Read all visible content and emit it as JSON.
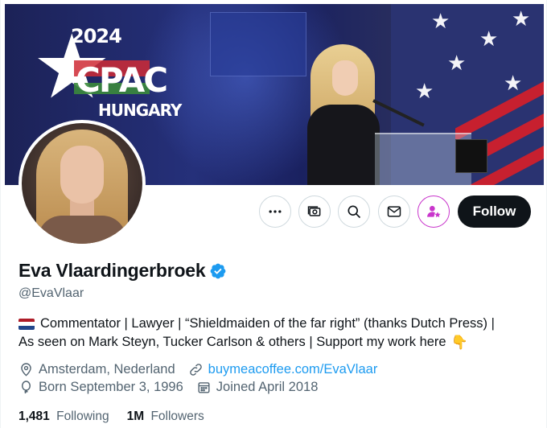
{
  "banner": {
    "event_year": "2024",
    "event_name": "CPAC",
    "event_country": "HUNGARY",
    "colors": {
      "red": "#cf2a35",
      "green": "#3b8a3c",
      "stage_blue": "#25307a"
    }
  },
  "actions": {
    "more_icon": "more-horizontal-icon",
    "subscribe_icon": "subscribe-icon",
    "search_icon": "search-icon",
    "message_icon": "envelope-icon",
    "person_icon": "person-star-icon",
    "follow_label": "Follow"
  },
  "profile": {
    "name": "Eva Vlaardingerbroek",
    "verified": true,
    "handle": "@EvaVlaar",
    "bio_line1": "Commentator | Lawyer | “Shieldmaiden of the far right” (thanks Dutch Press) |",
    "bio_line2": "As seen on Mark Steyn, Tucker Carlson & others | Support my work here",
    "bio_flag": "netherlands-flag",
    "bio_hand": "pointing-down-hand",
    "location": "Amsterdam, Nederland",
    "website": "buymeacoffee.com/EvaVlaar",
    "birthday": "Born September 3, 1996",
    "joined": "Joined April 2018",
    "following_count": "1,481",
    "following_label": "Following",
    "followers_count": "1M",
    "followers_label": "Followers"
  },
  "colors": {
    "text_primary": "#0f1419",
    "text_secondary": "#536471",
    "link": "#1d9bf0",
    "verified": "#1d9bf0",
    "follow_button": "#0f1419",
    "subscribe_accent": "#c936cc",
    "border": "#cfd9de"
  }
}
